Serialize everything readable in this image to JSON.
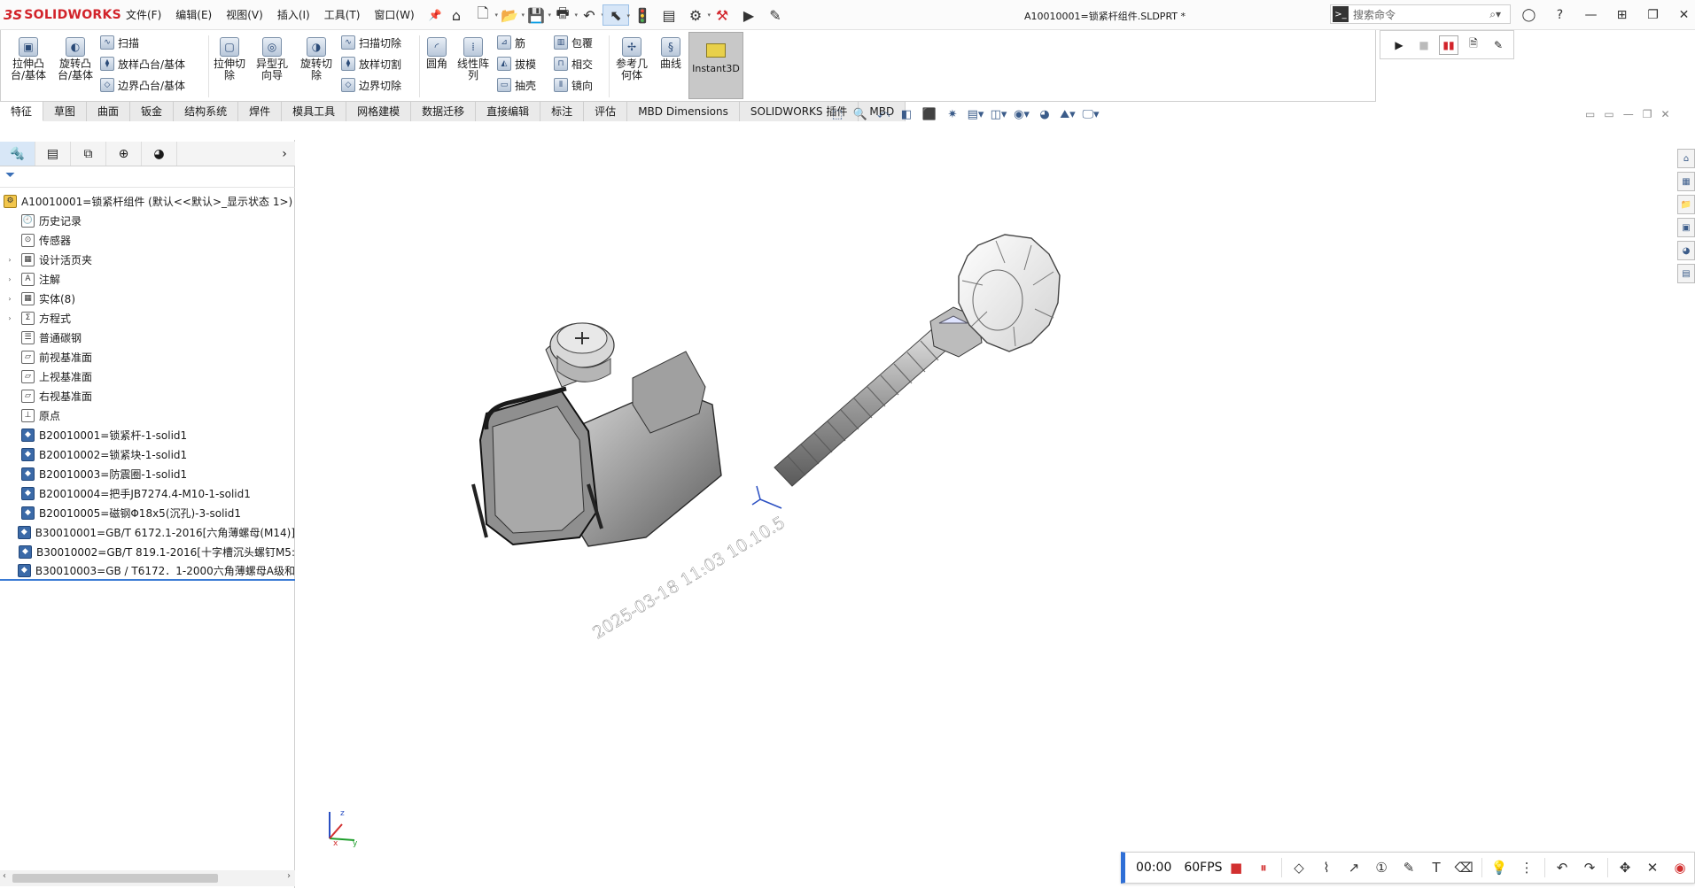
{
  "app": {
    "brand_prefix": "3S",
    "brand": "SOLIDWORKS",
    "doc_title": "A10010001=锁紧杆组件.SLDPRT *"
  },
  "menus": [
    "文件(F)",
    "编辑(E)",
    "视图(V)",
    "插入(I)",
    "工具(T)",
    "窗口(W)"
  ],
  "search": {
    "placeholder": "搜索命令"
  },
  "ribbon": {
    "extrude_boss": "拉伸凸\n台/基体",
    "revolve_boss": "旋转凸\n台/基体",
    "sweep": "扫描",
    "loft": "放样凸台/基体",
    "boundary_boss": "边界凸台/基体",
    "extrude_cut": "拉伸切\n除",
    "hole_wizard": "异型孔\n向导",
    "revolve_cut": "旋转切\n除",
    "sweep_cut": "扫描切除",
    "loft_cut": "放样切割",
    "boundary_cut": "边界切除",
    "fillet": "圆角",
    "linear_pattern": "线性阵\n列",
    "rib": "筋",
    "draft": "拔模",
    "shell": "抽壳",
    "wrap": "包覆",
    "intersect": "相交",
    "mirror": "镜向",
    "ref_geom": "参考几\n何体",
    "curves": "曲线",
    "instant3d": "Instant3D"
  },
  "tabs": [
    "特征",
    "草图",
    "曲面",
    "钣金",
    "结构系统",
    "焊件",
    "模具工具",
    "网格建模",
    "数据迁移",
    "直接编辑",
    "标注",
    "评估",
    "MBD Dimensions",
    "SOLIDWORKS 插件",
    "MBD"
  ],
  "tree": {
    "root": "A10010001=锁紧杆组件 (默认<<默认>_显示状态 1>)",
    "items": [
      {
        "label": "历史记录",
        "exp": false
      },
      {
        "label": "传感器",
        "exp": false
      },
      {
        "label": "设计活页夹",
        "exp": true
      },
      {
        "label": "注解",
        "exp": true
      },
      {
        "label": "实体(8)",
        "exp": true
      },
      {
        "label": "方程式",
        "exp": true
      },
      {
        "label": "普通碳钢",
        "exp": false
      },
      {
        "label": "前视基准面",
        "exp": false
      },
      {
        "label": "上视基准面",
        "exp": false
      },
      {
        "label": "右视基准面",
        "exp": false
      },
      {
        "label": "原点",
        "exp": false
      },
      {
        "label": "B20010001=锁紧杆-1-solid1",
        "exp": false
      },
      {
        "label": "B20010002=锁紧块-1-solid1",
        "exp": false
      },
      {
        "label": "B20010003=防震圈-1-solid1",
        "exp": false
      },
      {
        "label": "B20010004=把手JB7274.4-M10-1-solid1",
        "exp": false
      },
      {
        "label": "B20010005=磁钢Φ18x5(沉孔)-3-solid1",
        "exp": false
      },
      {
        "label": "B30010001=GB/T 6172.1-2016[六角薄螺母(M14)]",
        "exp": false
      },
      {
        "label": "B30010002=GB/T 819.1-2016[十字槽沉头螺钉M5:",
        "exp": false
      },
      {
        "label": "B30010003=GB / T6172．1-2000六角薄螺母A级和",
        "exp": false
      }
    ]
  },
  "watermark": "2025-03-18 11:03  10.10.5",
  "recorder": {
    "time": "00:00",
    "fps": "60FPS"
  },
  "colors": {
    "accent": "#2f6fd6",
    "brand": "#d2232a",
    "record": "#d23030"
  }
}
